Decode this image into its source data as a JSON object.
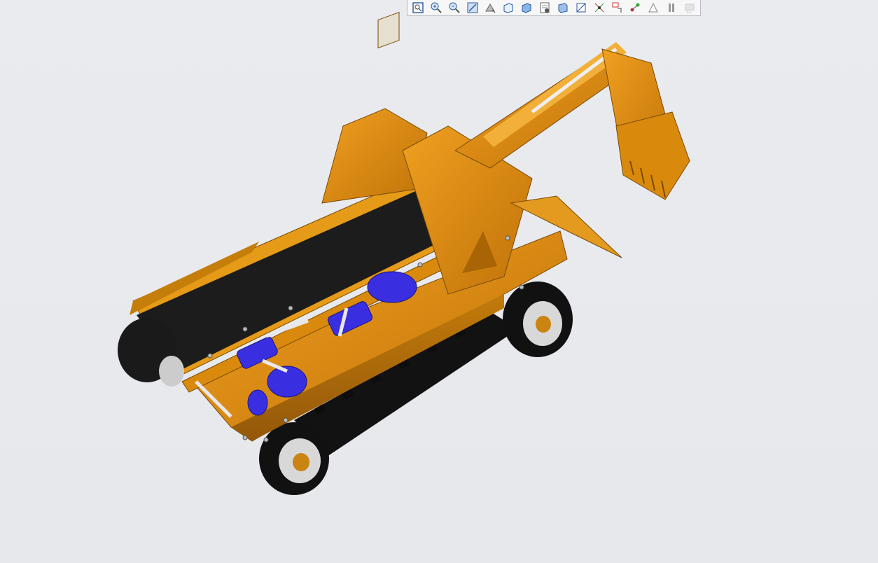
{
  "toolbar": {
    "buttons": [
      {
        "name": "refit-icon"
      },
      {
        "name": "zoom-in-icon"
      },
      {
        "name": "zoom-out-icon"
      },
      {
        "name": "repaint-icon"
      },
      {
        "name": "reorient-icon"
      },
      {
        "name": "saved-views-icon"
      },
      {
        "name": "display-style-icon"
      },
      {
        "name": "view-manager-icon"
      },
      {
        "name": "perspective-icon"
      },
      {
        "name": "section-icon"
      },
      {
        "name": "datum-display-icon"
      },
      {
        "name": "annotation-display-icon"
      },
      {
        "name": "spin-center-icon"
      },
      {
        "name": "simplified-rep-icon"
      },
      {
        "name": "pause-icon"
      },
      {
        "name": "graphics-disabled-icon"
      }
    ]
  },
  "colors": {
    "background": "#e8eaee",
    "body": "#d98a0c",
    "body_dark": "#a86405",
    "belt": "#1e1e1e",
    "blue_parts": "#3a2fe0",
    "track": "#151515"
  }
}
